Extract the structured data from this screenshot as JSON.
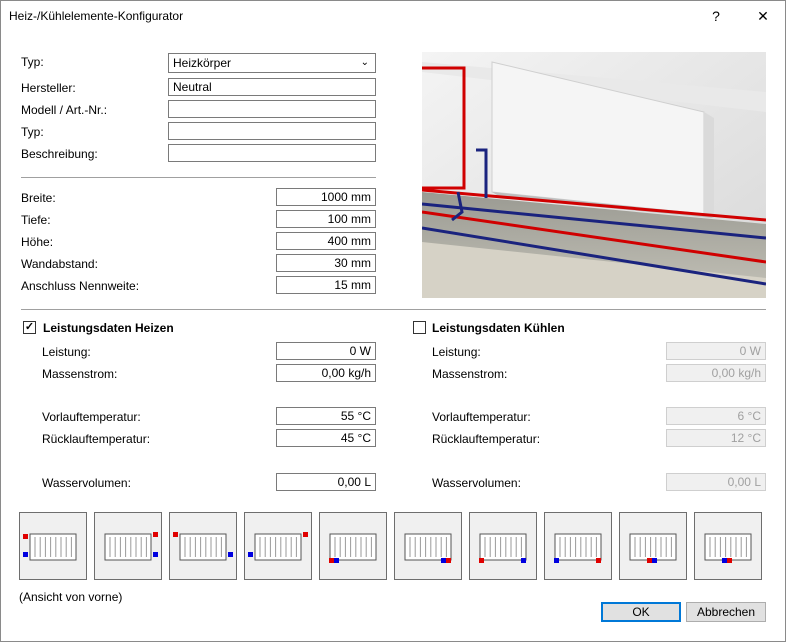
{
  "window": {
    "title": "Heiz-/Kühlelemente-Konfigurator",
    "help": "?",
    "close": "✕"
  },
  "general": {
    "typ_label": "Typ:",
    "typ_value": "Heizkörper",
    "hersteller_label": "Hersteller:",
    "hersteller_value": "Neutral",
    "modell_label": "Modell / Art.-Nr.:",
    "modell_value": "",
    "typ2_label": "Typ:",
    "typ2_value": "",
    "beschreibung_label": "Beschreibung:",
    "beschreibung_value": ""
  },
  "dims": {
    "breite_label": "Breite:",
    "breite_value": "1000 mm",
    "tiefe_label": "Tiefe:",
    "tiefe_value": "100 mm",
    "hoehe_label": "Höhe:",
    "hoehe_value": "400 mm",
    "wandabstand_label": "Wandabstand:",
    "wandabstand_value": "30 mm",
    "anschluss_label": "Anschluss Nennweite:",
    "anschluss_value": "15 mm"
  },
  "heizen": {
    "title": "Leistungsdaten Heizen",
    "checked": "✓",
    "leistung_label": "Leistung:",
    "leistung_value": "0 W",
    "massenstrom_label": "Massenstrom:",
    "massenstrom_value": "0,00 kg/h",
    "vorlauf_label": "Vorlauftemperatur:",
    "vorlauf_value": "55 °C",
    "ruecklauf_label": "Rücklauftemperatur:",
    "ruecklauf_value": "45 °C",
    "wasser_label": "Wasservolumen:",
    "wasser_value": "0,00 L"
  },
  "kuehlen": {
    "title": "Leistungsdaten Kühlen",
    "checked": "",
    "leistung_label": "Leistung:",
    "leistung_value": "0 W",
    "massenstrom_label": "Massenstrom:",
    "massenstrom_value": "0,00 kg/h",
    "vorlauf_label": "Vorlauftemperatur:",
    "vorlauf_value": "6 °C",
    "ruecklauf_label": "Rücklauftemperatur:",
    "ruecklauf_value": "12 °C",
    "wasser_label": "Wasservolumen:",
    "wasser_value": "0,00 L"
  },
  "connections": {
    "caption": "(Ansicht von vorne)",
    "colors": {
      "supply": "#e00000",
      "return": "#0000e0"
    }
  },
  "buttons": {
    "ok": "OK",
    "cancel": "Abbrechen"
  }
}
